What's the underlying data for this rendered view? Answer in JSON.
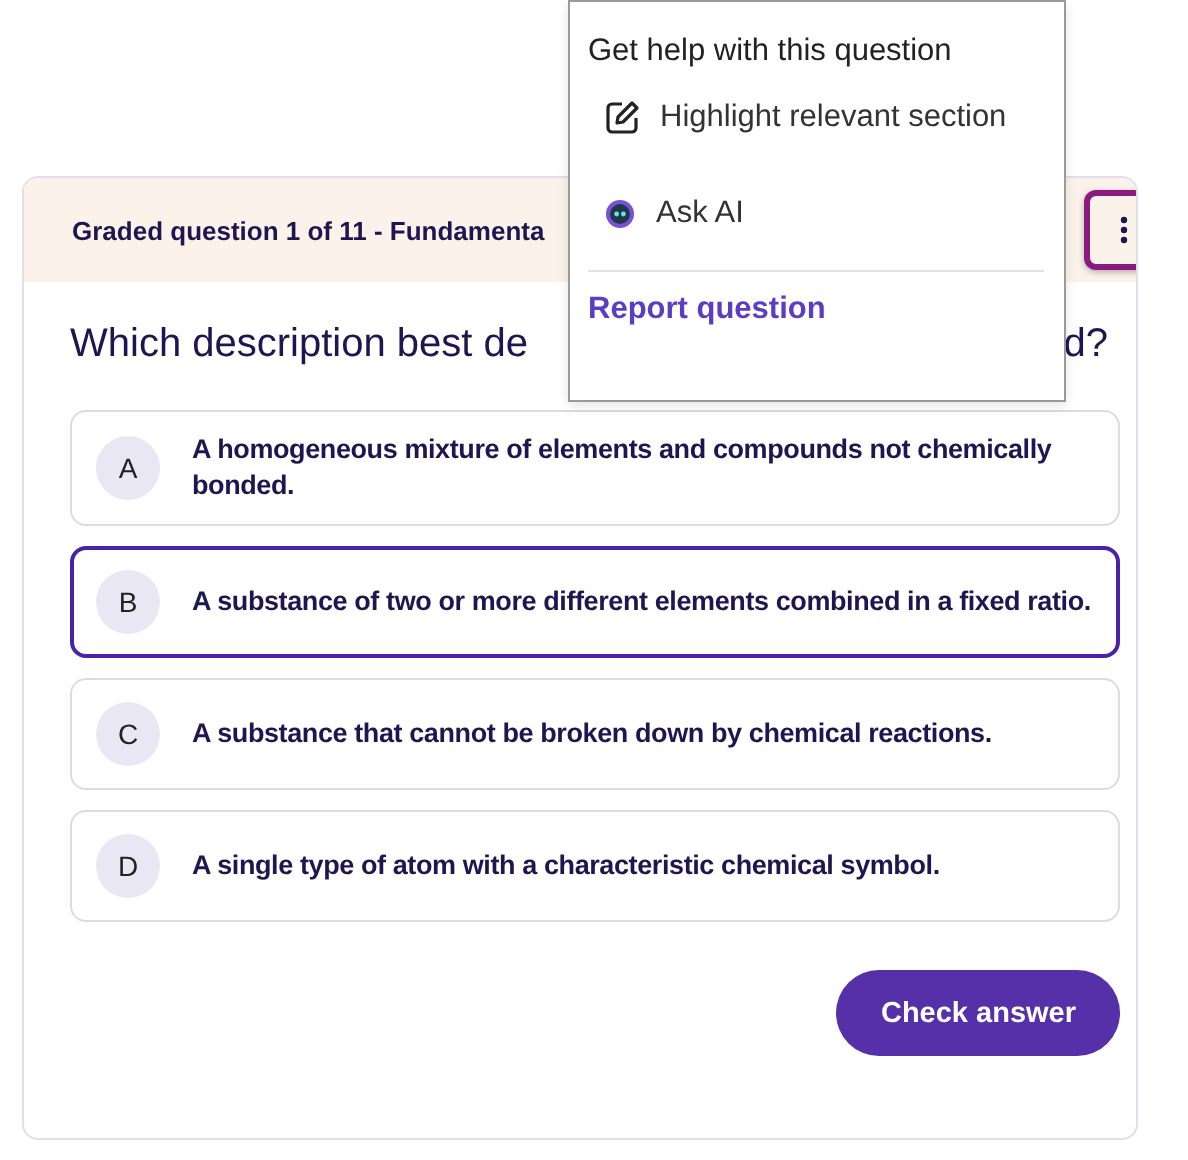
{
  "header": {
    "title": "Graded question 1 of 11 - Fundamenta"
  },
  "question": {
    "text_start": "Which description best de",
    "text_end": "d?"
  },
  "options": [
    {
      "letter": "A",
      "text": "A homogeneous mixture of elements and compounds not chemically bonded.",
      "selected": false
    },
    {
      "letter": "B",
      "text": "A substance of two or more different elements combined in a fixed ratio.",
      "selected": true
    },
    {
      "letter": "C",
      "text": "A substance that cannot be broken down by chemical reactions.",
      "selected": false
    },
    {
      "letter": "D",
      "text": "A single type of atom with a characteristic chemical symbol.",
      "selected": false
    }
  ],
  "check_button": "Check answer",
  "menu": {
    "title": "Get help with this question",
    "items": [
      {
        "kind": "edit",
        "label": "Highlight relevant section"
      },
      {
        "kind": "ai",
        "label": "Ask AI"
      }
    ],
    "report": "Report question"
  }
}
